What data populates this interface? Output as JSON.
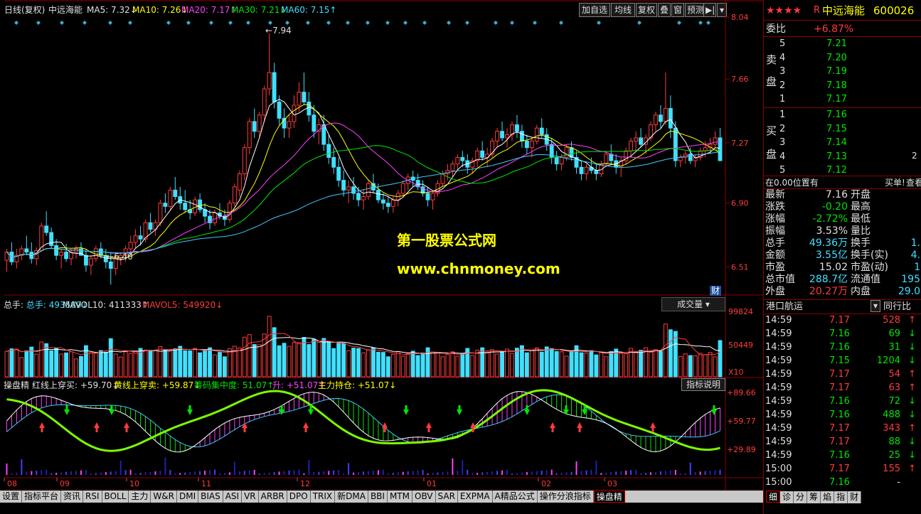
{
  "stock": {
    "name": "中远海能",
    "code": "600026",
    "stars": "★★★★",
    "prefix": "R"
  },
  "main_header": {
    "period": "日线(复权)",
    "name": "中远海能",
    "ma5": "MA5: 7.32↓",
    "ma10": "MA10: 7.26↓",
    "ma20": "MA20: 7.17↑",
    "ma30": "MA30: 7.21↓",
    "ma60": "MA60: 7.15↑"
  },
  "toolbar": [
    "加自选",
    "均线",
    "复权",
    "叠",
    "窗",
    "预测"
  ],
  "price_axis": [
    "8.04",
    "7.66",
    "7.27",
    "6.90",
    "6.51"
  ],
  "annotations": {
    "high": "7.94",
    "low": "6.40",
    "fin": "财"
  },
  "watermark": {
    "line1": "第一股票公式网",
    "line2": "www.chnmoney.com"
  },
  "vol_header": {
    "total": "总手: 493589↓",
    "mavol10": "MAVOL10: 411333↑",
    "mavol5": "MAVOL5: 549920↓",
    "selector": "成交量"
  },
  "vol_axis": [
    "99824",
    "50449",
    "X10"
  ],
  "ind_header": {
    "name": "操盘精",
    "hong": "红线上穿买: +59.70↓",
    "huang": "黄线上穿卖: +59.87↓",
    "chouma": "筹码集中度: 51.07↑",
    "sheng": "升: +51.07↑",
    "zhuli": "主力持仓: +51.07↓",
    "explain": "指标说明"
  },
  "ind_axis": [
    "+89.66",
    "+59.77",
    "+29.89"
  ],
  "months": [
    "08",
    "09",
    "10",
    "11",
    "12",
    "01",
    "02",
    "03"
  ],
  "tabs": [
    "设置",
    "指标平台",
    "资讯",
    "RSI",
    "BOLL",
    "主力",
    "W&R",
    "DMI",
    "BIAS",
    "ASI",
    "VR",
    "ARBR",
    "DPO",
    "TRIX",
    "新DMA",
    "BBI",
    "MTM",
    "OBV",
    "SAR",
    "EXPMA",
    "A精品公式",
    "操作分浪指标",
    "操盘精"
  ],
  "side": {
    "weibi_label": "委比",
    "weibi": "+6.87%",
    "sell_label": [
      "卖",
      "盘"
    ],
    "buy_label": [
      "买",
      "盘"
    ],
    "sells": [
      [
        "5",
        "7.21"
      ],
      [
        "4",
        "7.20"
      ],
      [
        "3",
        "7.19"
      ],
      [
        "2",
        "7.18"
      ],
      [
        "1",
        "7.17"
      ]
    ],
    "buys": [
      [
        "1",
        "7.16"
      ],
      [
        "2",
        "7.15"
      ],
      [
        "3",
        "7.14"
      ],
      [
        "4",
        "7.13"
      ],
      [
        "5",
        "7.12"
      ]
    ],
    "buy_extra": "2",
    "pos_text": "在0.00位置有",
    "buy1": "买单!",
    "view": "查看",
    "quotes": [
      [
        "最新",
        "7.16",
        "开盘"
      ],
      [
        "涨跌",
        "-0.20",
        "最高"
      ],
      [
        "涨幅",
        "-2.72%",
        "最低"
      ],
      [
        "振幅",
        "3.53%",
        "量比"
      ],
      [
        "总手",
        "49.36万",
        "换手",
        "1."
      ],
      [
        "金额",
        "3.55亿",
        "换手(实)",
        "4."
      ],
      [
        "市盈",
        "15.02",
        "市盈(动)",
        "1"
      ],
      [
        "总市值",
        "288.7亿",
        "流通值",
        "195"
      ],
      [
        "外盘",
        "20.27万",
        "内盘",
        "29.0"
      ]
    ],
    "industry": "港口航运",
    "industry_btn": "同行比",
    "ticks": [
      [
        "14:59",
        "7.17",
        "528",
        "up"
      ],
      [
        "14:59",
        "7.16",
        "69",
        "down"
      ],
      [
        "14:59",
        "7.16",
        "31",
        "down"
      ],
      [
        "14:59",
        "7.15",
        "1204",
        "down"
      ],
      [
        "14:59",
        "7.17",
        "54",
        "up"
      ],
      [
        "14:59",
        "7.17",
        "63",
        "up"
      ],
      [
        "14:59",
        "7.16",
        "72",
        "down"
      ],
      [
        "14:59",
        "7.16",
        "488",
        "down"
      ],
      [
        "14:59",
        "7.17",
        "343",
        "up"
      ],
      [
        "14:59",
        "7.17",
        "88",
        "down"
      ],
      [
        "14:59",
        "7.16",
        "25",
        "down"
      ],
      [
        "15:00",
        "7.17",
        "155",
        "up"
      ],
      [
        "15:00",
        "7.16",
        "-",
        "none"
      ]
    ],
    "bottom_tabs": [
      "细",
      "诊",
      "分",
      "筹",
      "焰",
      "指",
      "财"
    ]
  },
  "chart_data": {
    "type": "candlestick",
    "ylim": [
      6.35,
      8.04
    ],
    "n": 150,
    "ohlc_seed": [
      [
        6.55,
        6.62,
        6.48,
        6.6
      ],
      [
        6.6,
        6.66,
        6.52,
        6.54
      ],
      [
        6.54,
        6.62,
        6.5,
        6.58
      ],
      [
        6.58,
        6.64,
        6.55,
        6.62
      ],
      [
        6.62,
        6.7,
        6.58,
        6.6
      ],
      [
        6.6,
        6.66,
        6.53,
        6.56
      ],
      [
        6.56,
        6.63,
        6.52,
        6.61
      ],
      [
        6.61,
        6.78,
        6.6,
        6.76
      ],
      [
        6.76,
        6.85,
        6.7,
        6.72
      ],
      [
        6.72,
        6.75,
        6.62,
        6.64
      ],
      [
        6.64,
        6.68,
        6.55,
        6.58
      ],
      [
        6.58,
        6.62,
        6.5,
        6.6
      ],
      [
        6.6,
        6.65,
        6.54,
        6.56
      ],
      [
        6.56,
        6.62,
        6.52,
        6.6
      ],
      [
        6.6,
        6.64,
        6.56,
        6.62
      ],
      [
        6.62,
        6.66,
        6.58,
        6.58
      ],
      [
        6.58,
        6.62,
        6.48,
        6.52
      ],
      [
        6.52,
        6.58,
        6.46,
        6.56
      ],
      [
        6.56,
        6.64,
        6.54,
        6.62
      ],
      [
        6.62,
        6.66,
        6.56,
        6.58
      ],
      [
        6.58,
        6.62,
        6.5,
        6.54
      ],
      [
        6.54,
        6.6,
        6.4,
        6.5
      ],
      [
        6.5,
        6.58,
        6.46,
        6.56
      ],
      [
        6.56,
        6.6,
        6.52,
        6.58
      ],
      [
        6.58,
        6.64,
        6.54,
        6.62
      ],
      [
        6.62,
        6.7,
        6.58,
        6.66
      ],
      [
        6.66,
        6.74,
        6.62,
        6.7
      ],
      [
        6.7,
        6.76,
        6.64,
        6.68
      ],
      [
        6.68,
        6.8,
        6.66,
        6.78
      ],
      [
        6.78,
        6.84,
        6.72,
        6.74
      ],
      [
        6.74,
        6.8,
        6.7,
        6.78
      ],
      [
        6.78,
        6.92,
        6.76,
        6.9
      ],
      [
        6.9,
        6.96,
        6.84,
        6.88
      ],
      [
        6.88,
        7.0,
        6.86,
        6.98
      ],
      [
        6.98,
        7.06,
        6.92,
        6.94
      ],
      [
        6.94,
        7.0,
        6.86,
        6.9
      ],
      [
        6.9,
        6.98,
        6.84,
        6.86
      ],
      [
        6.86,
        6.92,
        6.8,
        6.84
      ],
      [
        6.84,
        6.94,
        6.82,
        6.92
      ],
      [
        6.92,
        6.96,
        6.84,
        6.86
      ],
      [
        6.86,
        6.9,
        6.78,
        6.82
      ],
      [
        6.82,
        6.86,
        6.74,
        6.78
      ],
      [
        6.78,
        6.86,
        6.76,
        6.84
      ],
      [
        6.84,
        6.9,
        6.8,
        6.82
      ],
      [
        6.82,
        6.86,
        6.76,
        6.8
      ],
      [
        6.8,
        6.92,
        6.78,
        6.9
      ],
      [
        6.9,
        7.02,
        6.88,
        7.0
      ],
      [
        6.98,
        7.1,
        6.94,
        7.08
      ],
      [
        7.08,
        7.26,
        7.04,
        7.24
      ],
      [
        7.24,
        7.42,
        7.2,
        7.4
      ],
      [
        7.4,
        7.48,
        7.3,
        7.34
      ],
      [
        7.34,
        7.46,
        7.3,
        7.44
      ],
      [
        7.44,
        7.62,
        7.4,
        7.6
      ],
      [
        7.6,
        7.94,
        7.56,
        7.7
      ],
      [
        7.7,
        7.76,
        7.48,
        7.52
      ],
      [
        7.52,
        7.56,
        7.38,
        7.42
      ],
      [
        7.42,
        7.48,
        7.3,
        7.36
      ],
      [
        7.36,
        7.44,
        7.3,
        7.4
      ],
      [
        7.4,
        7.56,
        7.36,
        7.5
      ],
      [
        7.5,
        7.64,
        7.46,
        7.58
      ],
      [
        7.58,
        7.7,
        7.5,
        7.52
      ],
      [
        7.52,
        7.58,
        7.4,
        7.44
      ],
      [
        7.44,
        7.5,
        7.3,
        7.34
      ],
      [
        7.34,
        7.42,
        7.26,
        7.38
      ],
      [
        7.38,
        7.44,
        7.22,
        7.26
      ],
      [
        7.26,
        7.32,
        7.14,
        7.18
      ],
      [
        7.18,
        7.24,
        7.08,
        7.12
      ],
      [
        7.12,
        7.18,
        7.0,
        7.04
      ],
      [
        7.04,
        7.1,
        6.94,
        6.98
      ],
      [
        6.98,
        7.04,
        6.9,
        7.0
      ],
      [
        7.0,
        7.06,
        6.92,
        6.96
      ],
      [
        6.96,
        7.0,
        6.88,
        6.92
      ],
      [
        6.92,
        6.98,
        6.86,
        6.94
      ],
      [
        6.94,
        7.04,
        6.92,
        7.02
      ],
      [
        7.02,
        7.08,
        6.96,
        6.98
      ],
      [
        6.98,
        7.02,
        6.9,
        6.92
      ],
      [
        6.92,
        6.96,
        6.86,
        6.9
      ],
      [
        6.9,
        6.94,
        6.84,
        6.88
      ],
      [
        6.88,
        6.94,
        6.84,
        6.92
      ],
      [
        6.92,
        6.98,
        6.88,
        6.96
      ],
      [
        6.96,
        7.04,
        6.94,
        7.02
      ],
      [
        7.02,
        7.08,
        6.98,
        7.06
      ],
      [
        7.06,
        7.1,
        7.0,
        7.04
      ],
      [
        7.04,
        7.08,
        6.98,
        7.0
      ],
      [
        7.0,
        7.04,
        6.94,
        6.96
      ],
      [
        6.96,
        7.0,
        6.88,
        6.92
      ],
      [
        6.92,
        6.98,
        6.86,
        6.96
      ],
      [
        6.96,
        7.04,
        6.94,
        7.02
      ],
      [
        7.02,
        7.1,
        7.0,
        7.08
      ],
      [
        7.08,
        7.14,
        7.04,
        7.1
      ],
      [
        7.1,
        7.16,
        7.06,
        7.14
      ],
      [
        7.14,
        7.2,
        7.1,
        7.18
      ],
      [
        7.18,
        7.22,
        7.12,
        7.16
      ],
      [
        7.16,
        7.2,
        7.08,
        7.12
      ],
      [
        7.12,
        7.18,
        7.08,
        7.16
      ],
      [
        7.16,
        7.24,
        7.12,
        7.22
      ],
      [
        7.22,
        7.28,
        7.16,
        7.18
      ],
      [
        7.18,
        7.24,
        7.12,
        7.2
      ],
      [
        7.2,
        7.3,
        7.18,
        7.28
      ],
      [
        7.28,
        7.36,
        7.24,
        7.34
      ],
      [
        7.34,
        7.4,
        7.28,
        7.3
      ],
      [
        7.3,
        7.36,
        7.24,
        7.32
      ],
      [
        7.32,
        7.4,
        7.28,
        7.38
      ],
      [
        7.38,
        7.44,
        7.3,
        7.34
      ],
      [
        7.34,
        7.38,
        7.24,
        7.28
      ],
      [
        7.28,
        7.32,
        7.2,
        7.24
      ],
      [
        7.24,
        7.3,
        7.18,
        7.28
      ],
      [
        7.28,
        7.38,
        7.26,
        7.36
      ],
      [
        7.36,
        7.42,
        7.3,
        7.32
      ],
      [
        7.32,
        7.36,
        7.22,
        7.26
      ],
      [
        7.26,
        7.3,
        7.14,
        7.18
      ],
      [
        7.18,
        7.22,
        7.1,
        7.14
      ],
      [
        7.14,
        7.2,
        7.1,
        7.18
      ],
      [
        7.18,
        7.26,
        7.16,
        7.24
      ],
      [
        7.24,
        7.28,
        7.16,
        7.18
      ],
      [
        7.18,
        7.22,
        7.08,
        7.12
      ],
      [
        7.12,
        7.16,
        7.04,
        7.08
      ],
      [
        7.08,
        7.14,
        7.04,
        7.12
      ],
      [
        7.12,
        7.18,
        7.08,
        7.1
      ],
      [
        7.1,
        7.14,
        7.04,
        7.08
      ],
      [
        7.08,
        7.16,
        7.06,
        7.14
      ],
      [
        7.14,
        7.22,
        7.12,
        7.2
      ],
      [
        7.2,
        7.26,
        7.14,
        7.16
      ],
      [
        7.16,
        7.2,
        7.08,
        7.12
      ],
      [
        7.12,
        7.18,
        7.06,
        7.16
      ],
      [
        7.16,
        7.24,
        7.14,
        7.22
      ],
      [
        7.22,
        7.3,
        7.18,
        7.28
      ],
      [
        7.28,
        7.34,
        7.22,
        7.3
      ],
      [
        7.3,
        7.36,
        7.24,
        7.26
      ],
      [
        7.26,
        7.32,
        7.2,
        7.3
      ],
      [
        7.3,
        7.4,
        7.28,
        7.38
      ],
      [
        7.38,
        7.46,
        7.34,
        7.44
      ],
      [
        7.44,
        7.5,
        7.36,
        7.4
      ],
      [
        7.4,
        7.7,
        7.38,
        7.48
      ],
      [
        7.48,
        7.56,
        7.3,
        7.36
      ],
      [
        7.36,
        7.4,
        7.12,
        7.16
      ],
      [
        7.16,
        7.2,
        7.12,
        7.18
      ],
      [
        7.18,
        7.22,
        7.14,
        7.2
      ],
      [
        7.2,
        7.24,
        7.14,
        7.16
      ],
      [
        7.16,
        7.2,
        7.12,
        7.18
      ],
      [
        7.18,
        7.24,
        7.16,
        7.22
      ],
      [
        7.22,
        7.28,
        7.18,
        7.24
      ],
      [
        7.24,
        7.3,
        7.2,
        7.26
      ],
      [
        7.26,
        7.34,
        7.24,
        7.3
      ],
      [
        7.3,
        7.36,
        7.16,
        7.16
      ]
    ]
  }
}
